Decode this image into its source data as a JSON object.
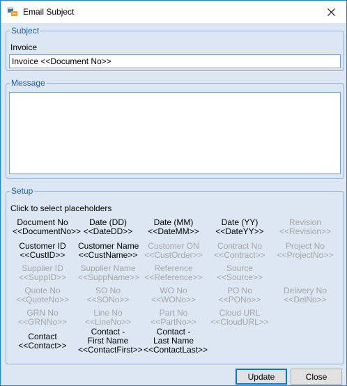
{
  "window": {
    "title": "Email Subject",
    "close_glyph": "✕"
  },
  "subject": {
    "legend": "Subject",
    "label": "Invoice",
    "value": "Invoice <<Document No>>"
  },
  "message": {
    "legend": "Message",
    "value": ""
  },
  "setup": {
    "legend": "Setup",
    "hint": "Click to select placeholders",
    "placeholders": [
      {
        "name": "Document No",
        "token": "<<DocumentNo>>",
        "enabled": true
      },
      {
        "name": "Date (DD)",
        "token": "<<DateDD>>",
        "enabled": true
      },
      {
        "name": "Date (MM)",
        "token": "<<DateMM>>",
        "enabled": true
      },
      {
        "name": "Date (YY)",
        "token": "<<DateYY>>",
        "enabled": true
      },
      {
        "name": "Revision",
        "token": "<<Revision>>",
        "enabled": false
      },
      {
        "name": "Customer ID",
        "token": "<<CustID>>",
        "enabled": true
      },
      {
        "name": "Customer Name",
        "token": "<<CustName>>",
        "enabled": true
      },
      {
        "name": "Customer ON",
        "token": "<<CustOrder>>",
        "enabled": false
      },
      {
        "name": "Contract No",
        "token": "<<Contract>>",
        "enabled": false
      },
      {
        "name": "Project No",
        "token": "<<ProjectNo>>",
        "enabled": false
      },
      {
        "name": "Supplier ID",
        "token": "<<SuppID>>",
        "enabled": false
      },
      {
        "name": "Supplier Name",
        "token": "<<SuppName>>",
        "enabled": false
      },
      {
        "name": "Reference",
        "token": "<<Reference>>",
        "enabled": false
      },
      {
        "name": "Source",
        "token": "<<Source>>",
        "enabled": false
      },
      {
        "name": "Quote No",
        "token": "<<QuoteNo>>",
        "enabled": false
      },
      {
        "name": "SO No",
        "token": "<<SONo>>",
        "enabled": false
      },
      {
        "name": "WO No",
        "token": "<<WONo>>",
        "enabled": false
      },
      {
        "name": "PO No",
        "token": "<<PONo>>",
        "enabled": false
      },
      {
        "name": "Delivery No",
        "token": "<<DelNo>>",
        "enabled": false
      },
      {
        "name": "GRN No",
        "token": "<<GRNNo>>",
        "enabled": false
      },
      {
        "name": "Line No",
        "token": "<<LineNo>>",
        "enabled": false
      },
      {
        "name": "Part No",
        "token": "<<PartNo>>",
        "enabled": false
      },
      {
        "name": "Cloud URL",
        "token": "<<CloudURL>>",
        "enabled": false
      },
      {
        "name": "Contact",
        "token": "<<Contact>>",
        "enabled": true
      },
      {
        "name": "Contact -\nFirst Name",
        "token": "<<ContactFirst>>",
        "enabled": true
      },
      {
        "name": "Contact -\nLast Name",
        "token": "<<ContactLast>>",
        "enabled": true
      }
    ]
  },
  "buttons": {
    "update": "Update",
    "close": "Close"
  },
  "colors": {
    "dialog_bg": "#dce7f3",
    "legend_text": "#1e5fa8",
    "disabled_text": "#a6a6a6",
    "accent": "#0078d7"
  }
}
